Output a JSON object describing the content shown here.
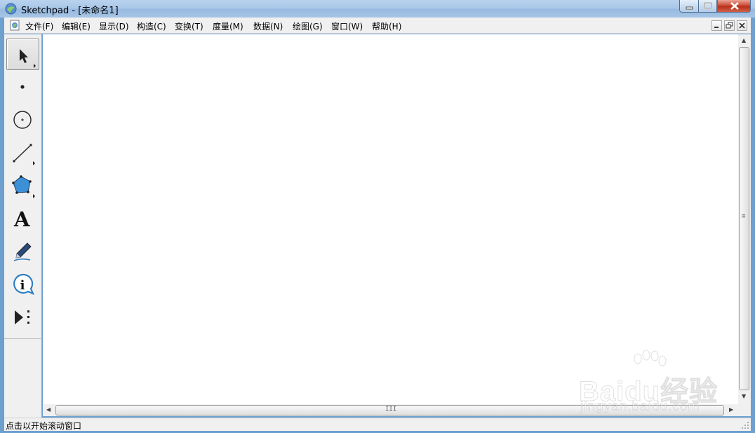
{
  "window": {
    "title": "Sketchpad  - [未命名1]"
  },
  "menu": {
    "items": [
      {
        "label": "文件(F)",
        "name": "menu-file"
      },
      {
        "label": "编辑(E)",
        "name": "menu-edit"
      },
      {
        "label": "显示(D)",
        "name": "menu-display"
      },
      {
        "label": "构造(C)",
        "name": "menu-construct"
      },
      {
        "label": "变换(T)",
        "name": "menu-transform"
      },
      {
        "label": "度量(M)",
        "name": "menu-measure"
      },
      {
        "label": "数据(N)",
        "name": "menu-number"
      },
      {
        "label": "绘图(G)",
        "name": "menu-graph"
      },
      {
        "label": "窗口(W)",
        "name": "menu-window"
      },
      {
        "label": "帮助(H)",
        "name": "menu-help"
      }
    ]
  },
  "toolbox": {
    "tools": [
      {
        "name": "arrow-tool",
        "icon": "arrow-icon",
        "selected": true
      },
      {
        "name": "point-tool",
        "icon": "point-icon",
        "selected": false
      },
      {
        "name": "compass-tool",
        "icon": "compass-circle-icon",
        "selected": false
      },
      {
        "name": "straightedge-tool",
        "icon": "segment-icon",
        "selected": false
      },
      {
        "name": "polygon-tool",
        "icon": "polygon-icon",
        "selected": false
      },
      {
        "name": "text-tool",
        "icon": "text-a-icon",
        "selected": false
      },
      {
        "name": "marker-tool",
        "icon": "marker-pen-icon",
        "selected": false
      },
      {
        "name": "information-tool",
        "icon": "info-icon",
        "selected": false
      },
      {
        "name": "custom-tool",
        "icon": "custom-tool-icon",
        "selected": false
      }
    ],
    "text_tool_glyph": "A"
  },
  "statusbar": {
    "text": "点击以开始滚动窗口"
  },
  "watermark": {
    "brand": "Baidu经验",
    "url": "jingyan.baidu.com"
  },
  "colors": {
    "polygon_fill": "#3d8fd6",
    "info_blue": "#2f7fc1",
    "close_red": "#c8432d"
  }
}
